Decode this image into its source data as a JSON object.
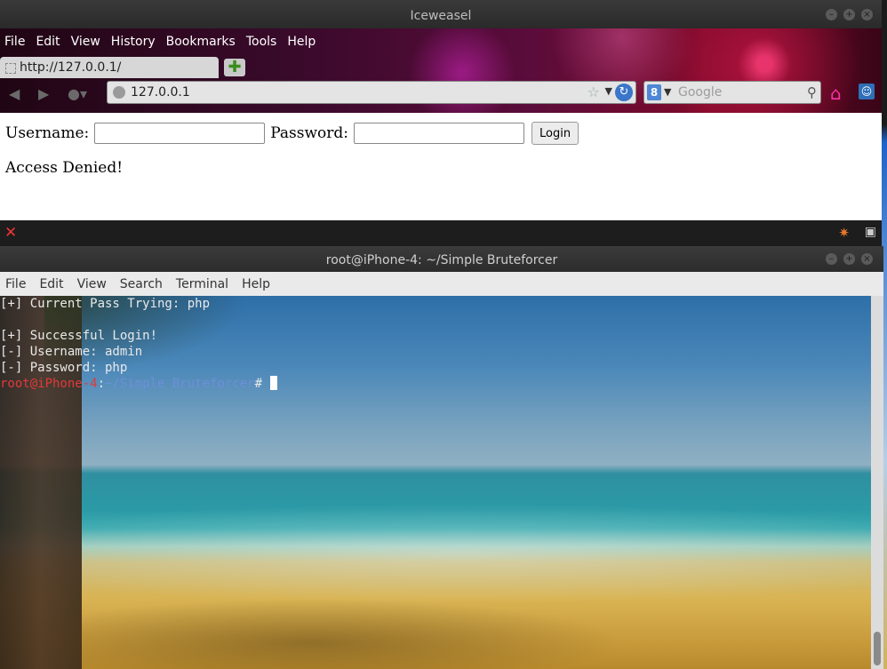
{
  "browser": {
    "title": "Iceweasel",
    "menu": [
      "File",
      "Edit",
      "View",
      "History",
      "Bookmarks",
      "Tools",
      "Help"
    ],
    "tab_label": "http://127.0.0.1/",
    "url": "127.0.0.1",
    "search_placeholder": "Google",
    "search_engine_badge": "8"
  },
  "page": {
    "username_label": "Username:",
    "password_label": "Password:",
    "login_button": "Login",
    "username_value": "",
    "password_value": "",
    "message": "Access Denied!"
  },
  "terminal": {
    "title": "root@iPhone-4: ~/Simple Bruteforcer",
    "menu": [
      "File",
      "Edit",
      "View",
      "Search",
      "Terminal",
      "Help"
    ],
    "lines": [
      "[+] Current Pass Trying: php",
      "",
      "[+] Successful Login!",
      "[-] Username: admin",
      "[-] Password: php"
    ],
    "prompt_user": "root@iPhone-4",
    "prompt_sep": ":",
    "prompt_path": "~/Simple Bruteforcer",
    "prompt_symbol": "# "
  },
  "colors": {
    "prompt_user": "#e03a3a",
    "prompt_path": "#6d8fd9",
    "chrome_theme": "#5a0c3a"
  }
}
